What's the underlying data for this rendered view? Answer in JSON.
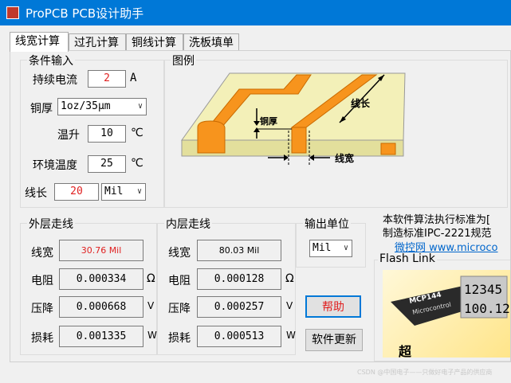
{
  "window": {
    "title": "ProPCB PCB设计助手"
  },
  "tabs": [
    {
      "label": "线宽计算"
    },
    {
      "label": "过孔计算"
    },
    {
      "label": "铜线计算"
    },
    {
      "label": "洗板填单"
    }
  ],
  "conditions": {
    "legend": "条件输入",
    "current": {
      "label": "持续电流",
      "value": "2",
      "unit": "A"
    },
    "thickness": {
      "label": "铜厚",
      "selected": "1oz/35μm"
    },
    "temp_rise": {
      "label": "温升",
      "value": "10",
      "unit": "℃"
    },
    "ambient": {
      "label": "环境温度",
      "value": "25",
      "unit": "℃"
    },
    "length": {
      "label": "线长",
      "value": "20",
      "unit_selected": "Mil"
    }
  },
  "diagram": {
    "legend": "图例",
    "labels": {
      "thickness": "铜厚",
      "length": "线长",
      "width": "线宽"
    },
    "colors": {
      "board": "#f3f0b8",
      "trace": "#f7941d"
    }
  },
  "outer": {
    "legend": "外层走线",
    "width_label": "线宽",
    "width_value": "30.76 Mil",
    "resistance_label": "电阻",
    "resistance_value": "0.000334",
    "resistance_unit": "Ω",
    "drop_label": "压降",
    "drop_value": "0.000668",
    "drop_unit": "V",
    "loss_label": "损耗",
    "loss_value": "0.001335",
    "loss_unit": "W"
  },
  "inner": {
    "legend": "内层走线",
    "width_label": "线宽",
    "width_value": "80.03 Mil",
    "resistance_label": "电阻",
    "resistance_value": "0.000128",
    "resistance_unit": "Ω",
    "drop_label": "压降",
    "drop_value": "0.000257",
    "drop_unit": "V",
    "loss_label": "损耗",
    "loss_value": "0.000513",
    "loss_unit": "W"
  },
  "output_unit": {
    "legend": "输出单位",
    "selected": "Mil"
  },
  "buttons": {
    "help": "帮助",
    "update": "软件更新"
  },
  "info": {
    "line1": "本软件算法执行标准为[",
    "line2": "制造标准IPC-2221规范",
    "link": "微控网 www.microco"
  },
  "flash": {
    "legend": "Flash Link",
    "chip_label": "MCP144",
    "chip_sub": "Microcontrol",
    "display_top": "12345",
    "display_bottom": "100.12",
    "caption": "超"
  },
  "watermark": "CSDN @中国电子——只做好电子产品的供应商"
}
